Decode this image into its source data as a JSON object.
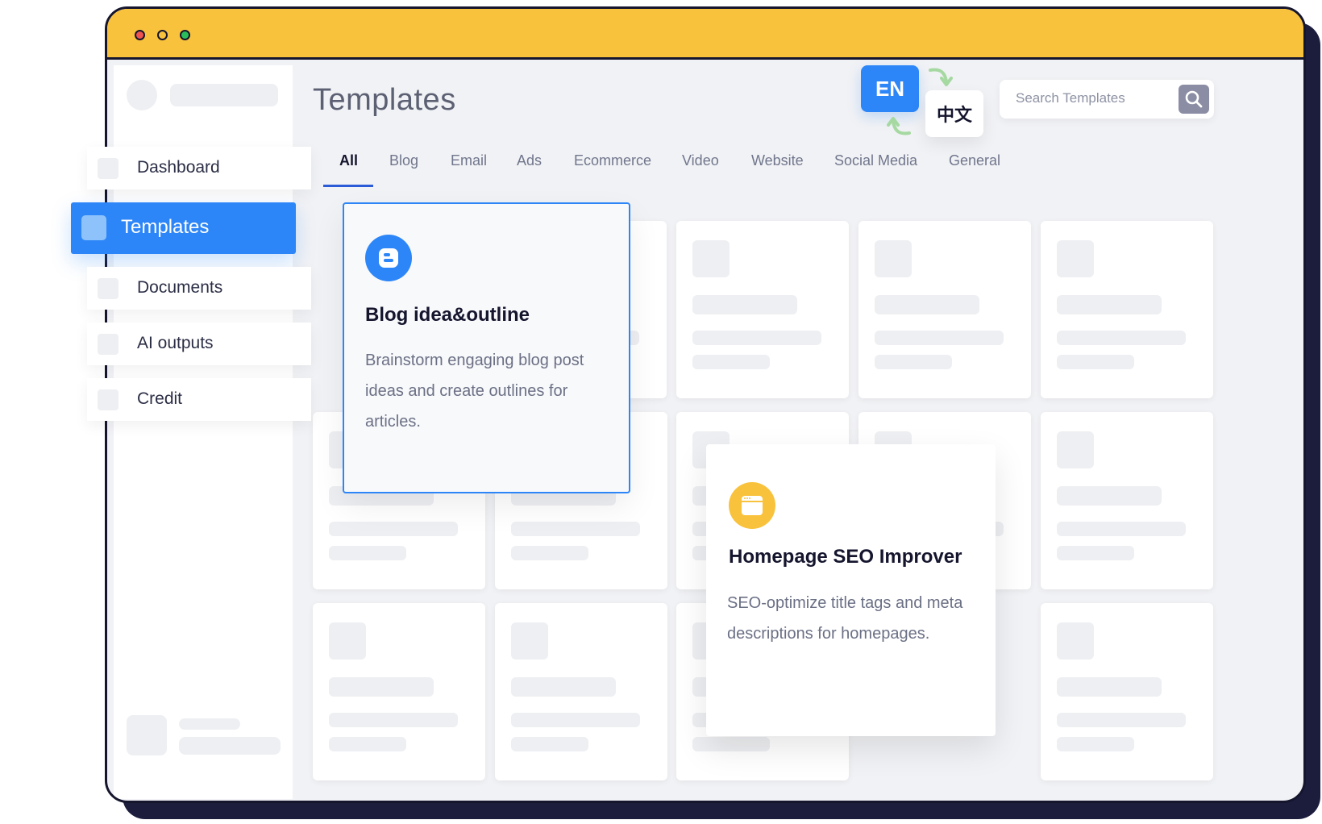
{
  "page": {
    "title": "Templates"
  },
  "language": {
    "primary": "EN",
    "secondary": "中文"
  },
  "search": {
    "placeholder": "Search Templates"
  },
  "tabs": [
    {
      "label": "All"
    },
    {
      "label": "Blog"
    },
    {
      "label": "Email"
    },
    {
      "label": "Ads"
    },
    {
      "label": "Ecommerce"
    },
    {
      "label": "Video"
    },
    {
      "label": "Website"
    },
    {
      "label": "Social Media"
    },
    {
      "label": "General"
    }
  ],
  "nav": {
    "dashboard": "Dashboard",
    "templates": "Templates",
    "documents": "Documents",
    "ai_outputs": "AI outputs",
    "credit": "Credit"
  },
  "featured": [
    {
      "title": "Blog idea&outline",
      "description": "Brainstorm engaging blog post ideas and create outlines for articles.",
      "icon": "blogger-icon"
    },
    {
      "title": "Homepage SEO Improver",
      "description": "SEO-optimize title tags and meta descriptions for homepages.",
      "icon": "browser-window-icon"
    }
  ],
  "colors": {
    "titlebar": "#f9c23c",
    "accent": "#2d86f7",
    "frame": "#15152e",
    "seo_icon": "#f9c23c"
  }
}
